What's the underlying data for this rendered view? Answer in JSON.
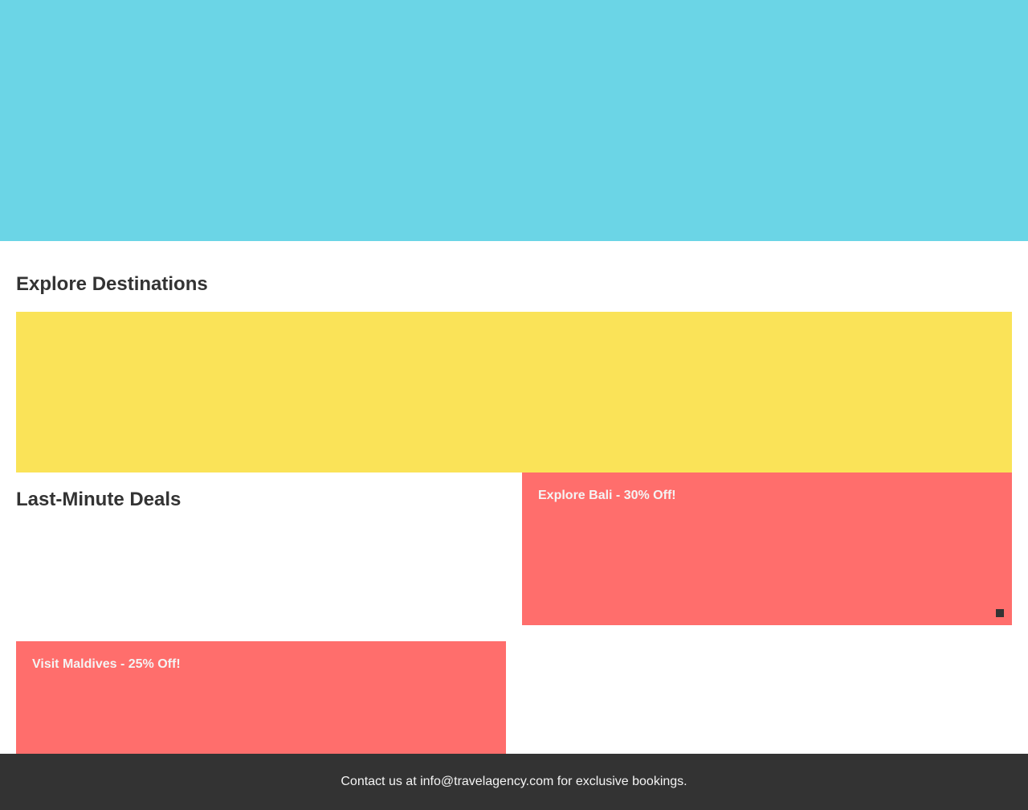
{
  "colors": {
    "hero": "#6bd5e6",
    "banner": "#fae358",
    "deal_card": "#ff6e6c",
    "footer": "#333333",
    "text": "#333333",
    "light_text": "#f4f4f4"
  },
  "explore": {
    "title": "Explore Destinations"
  },
  "deals": {
    "title": "Last-Minute Deals",
    "items": [
      {
        "label": "Explore Bali - 30% Off!"
      },
      {
        "label": "Visit Maldives - 25% Off!"
      }
    ]
  },
  "footer": {
    "text": "Contact us at info@travelagency.com for exclusive bookings."
  }
}
